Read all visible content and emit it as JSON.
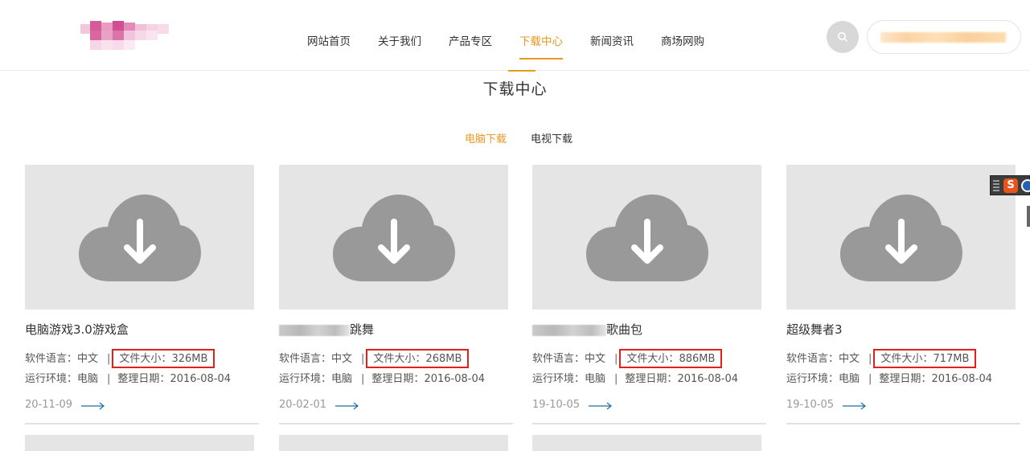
{
  "header": {
    "nav": [
      {
        "label": "网站首页",
        "active": false
      },
      {
        "label": "关于我们",
        "active": false
      },
      {
        "label": "产品专区",
        "active": false
      },
      {
        "label": "下载中心",
        "active": true
      },
      {
        "label": "新闻资讯",
        "active": false
      },
      {
        "label": "商场网购",
        "active": false
      }
    ],
    "search_icon": "search-icon"
  },
  "page": {
    "title": "下载中心"
  },
  "tabs": [
    {
      "label": "电脑下载",
      "active": true
    },
    {
      "label": "电视下载",
      "active": false
    }
  ],
  "labels": {
    "language": "软件语言：",
    "size": "文件大小：",
    "env": "运行环境：",
    "date": "整理日期：",
    "sep": "|"
  },
  "cards": [
    {
      "title": "电脑游戏3.0游戏盒",
      "language": "中文",
      "size": "326MB",
      "env": "电脑",
      "date": "2016-08-04",
      "posted": "20-11-09"
    },
    {
      "title": "跳舞",
      "language": "中文",
      "size": "268MB",
      "env": "电脑",
      "date": "2016-08-04",
      "posted": "20-02-01"
    },
    {
      "title": "歌曲包",
      "language": "中文",
      "size": "886MB",
      "env": "电脑",
      "date": "2016-08-04",
      "posted": "19-10-05"
    },
    {
      "title": "超级舞者3",
      "language": "中文",
      "size": "717MB",
      "env": "电脑",
      "date": "2016-08-04",
      "posted": "19-10-05"
    }
  ],
  "colors": {
    "accent": "#e8981f",
    "highlight_box": "#e0201a",
    "thumb_bg": "#e5e5e5",
    "cloud": "#999999",
    "arrow": "#1c6fa8"
  },
  "widget": {
    "ime_letter": "S"
  }
}
